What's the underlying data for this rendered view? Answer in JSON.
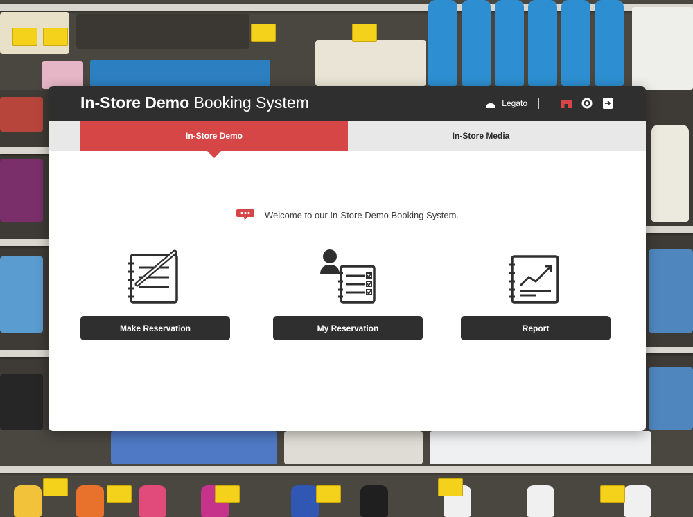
{
  "header": {
    "title_strong": "In-Store Demo",
    "title_light": "Booking System",
    "user_name": "Legato",
    "icons": [
      "user-icon",
      "store-icon",
      "settings-icon",
      "logout-icon"
    ]
  },
  "tabs": [
    {
      "label": "In-Store Demo",
      "active": true
    },
    {
      "label": "In-Store Media",
      "active": false
    }
  ],
  "welcome": {
    "text": "Welcome to our In-Store Demo Booking System.",
    "icon": "chat-bubble-icon"
  },
  "actions": [
    {
      "label": "Make Reservation",
      "icon": "notepad-pen-icon"
    },
    {
      "label": "My Reservation",
      "icon": "user-checklist-icon"
    },
    {
      "label": "Report",
      "icon": "chart-report-icon"
    }
  ],
  "colors": {
    "accent": "#d64646",
    "header_bg": "#2f2f30",
    "tab_inactive_bg": "#e8e8e8",
    "button_bg": "#2f2f30"
  }
}
